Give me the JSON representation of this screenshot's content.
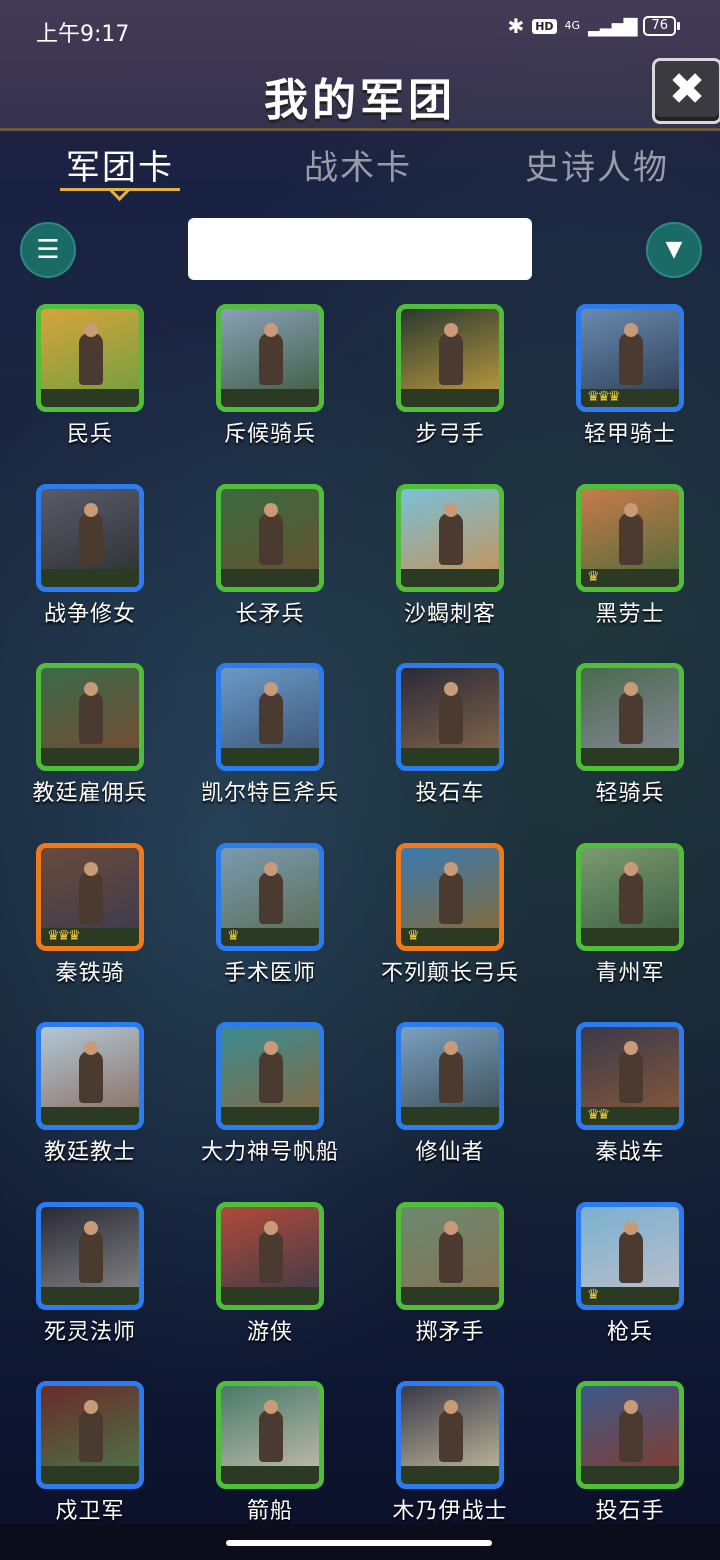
{
  "status": {
    "time": "上午9:17",
    "icons": [
      "bluetooth-icon",
      "hd-icon",
      "signal-4g-icon"
    ],
    "hd_label": "HD",
    "network": "4G",
    "battery": "76"
  },
  "header": {
    "title": "我的军团",
    "close_icon": "close-icon",
    "close_symbol": "✖"
  },
  "tabs": [
    {
      "label": "军团卡",
      "active": true
    },
    {
      "label": "战术卡",
      "active": false
    },
    {
      "label": "史诗人物",
      "active": false
    }
  ],
  "toolbar": {
    "list_icon": "list-icon",
    "list_symbol": "☰",
    "filter_icon": "filter-icon",
    "filter_symbol": "▼",
    "search_value": ""
  },
  "colors": {
    "rarity_green": "#4fbf3a",
    "rarity_blue": "#2a7cf0",
    "rarity_orange": "#f07a1a",
    "crown": "#f4cf3a",
    "accent_gold": "#e0b040",
    "button_teal": "#1a6a66"
  },
  "cards": [
    {
      "name": "民兵",
      "rarity": "green",
      "crowns": 0
    },
    {
      "name": "斥候骑兵",
      "rarity": "green",
      "crowns": 0
    },
    {
      "name": "步弓手",
      "rarity": "green",
      "crowns": 0
    },
    {
      "name": "轻甲骑士",
      "rarity": "blue",
      "crowns": 3
    },
    {
      "name": "战争修女",
      "rarity": "blue",
      "crowns": 0
    },
    {
      "name": "长矛兵",
      "rarity": "green",
      "crowns": 0
    },
    {
      "name": "沙蝎刺客",
      "rarity": "green",
      "crowns": 0
    },
    {
      "name": "黑劳士",
      "rarity": "green",
      "crowns": 1
    },
    {
      "name": "教廷雇佣兵",
      "rarity": "green",
      "crowns": 0
    },
    {
      "name": "凯尔特巨斧兵",
      "rarity": "blue",
      "crowns": 0
    },
    {
      "name": "投石车",
      "rarity": "blue",
      "crowns": 0
    },
    {
      "name": "轻骑兵",
      "rarity": "green",
      "crowns": 0
    },
    {
      "name": "秦铁骑",
      "rarity": "orange",
      "crowns": 3
    },
    {
      "name": "手术医师",
      "rarity": "blue",
      "crowns": 1
    },
    {
      "name": "不列颠长弓兵",
      "rarity": "orange",
      "crowns": 1
    },
    {
      "name": "青州军",
      "rarity": "green",
      "crowns": 0
    },
    {
      "name": "教廷教士",
      "rarity": "blue",
      "crowns": 0
    },
    {
      "name": "大力神号帆船",
      "rarity": "blue",
      "crowns": 0
    },
    {
      "name": "修仙者",
      "rarity": "blue",
      "crowns": 0
    },
    {
      "name": "秦战车",
      "rarity": "blue",
      "crowns": 2
    },
    {
      "name": "死灵法师",
      "rarity": "blue",
      "crowns": 0
    },
    {
      "name": "游侠",
      "rarity": "green",
      "crowns": 0
    },
    {
      "name": "掷矛手",
      "rarity": "green",
      "crowns": 0
    },
    {
      "name": "枪兵",
      "rarity": "blue",
      "crowns": 1
    },
    {
      "name": "戍卫军",
      "rarity": "blue",
      "crowns": 0
    },
    {
      "name": "箭船",
      "rarity": "green",
      "crowns": 0
    },
    {
      "name": "木乃伊战士",
      "rarity": "blue",
      "crowns": 0
    },
    {
      "name": "投石手",
      "rarity": "green",
      "crowns": 0
    }
  ]
}
